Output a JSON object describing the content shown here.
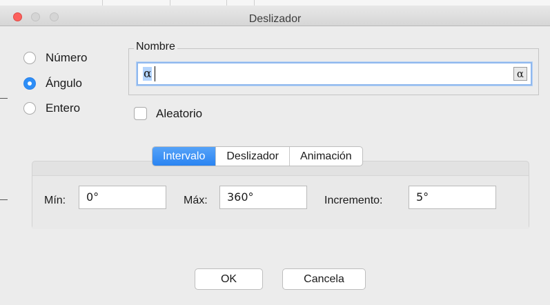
{
  "window": {
    "title": "Deslizador"
  },
  "type_options": {
    "items": [
      {
        "label": "Número",
        "checked": false
      },
      {
        "label": "Ángulo",
        "checked": true
      },
      {
        "label": "Entero",
        "checked": false
      }
    ]
  },
  "name_group": {
    "legend": "Nombre",
    "value": "α",
    "symbol_button": "α"
  },
  "random_checkbox": {
    "label": "Aleatorio",
    "checked": false
  },
  "tabs": [
    {
      "label": "Intervalo",
      "active": true
    },
    {
      "label": "Deslizador",
      "active": false
    },
    {
      "label": "Animación",
      "active": false
    }
  ],
  "interval": {
    "min_label": "Mín:",
    "min_value": "0°",
    "max_label": "Máx:",
    "max_value": "360°",
    "increment_label": "Incremento:",
    "increment_value": "5°"
  },
  "buttons": {
    "ok": "OK",
    "cancel": "Cancela"
  },
  "colors": {
    "accent": "#2d8ef7",
    "close_button": "#fc605c",
    "selection": "#b3d4fd"
  }
}
